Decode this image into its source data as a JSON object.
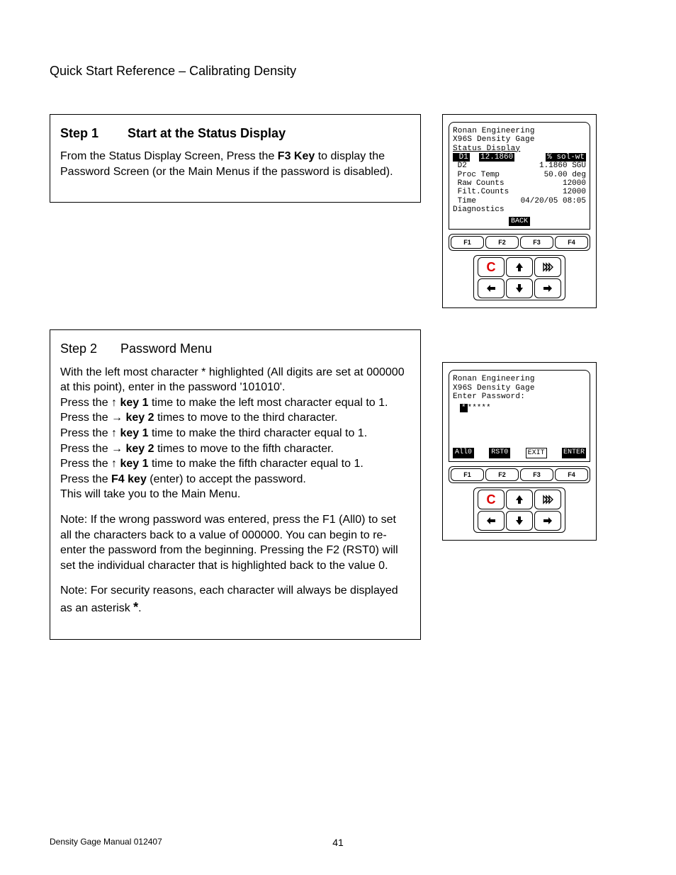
{
  "page_title": "Quick Start Reference – Calibrating Density",
  "step1": {
    "label": "Step 1",
    "heading": "Start at the Status Display",
    "body_pre": "From the Status Display Screen, Press the ",
    "key": "F3 Key",
    "body_post": " to display the Password Screen (or the Main Menus if the password is disabled)."
  },
  "step2": {
    "label": "Step 2",
    "heading": "Password Menu",
    "intro": "With the left most character * highlighted (All digits are set at 000000 at this point), enter in the password '101010'.",
    "lines": [
      {
        "pre": "Press the ",
        "arrow": "↑",
        "mid": "  ",
        "key": "key 1",
        "post": " time to make the left most character equal to 1."
      },
      {
        "pre": "Press the ",
        "arrow": "→",
        "mid": " ",
        "key": "key 2",
        "post": " times to move to the third character."
      },
      {
        "pre": "Press the ",
        "arrow": "↑",
        "mid": "  ",
        "key": "key 1",
        "post": " time to make the third character equal to 1."
      },
      {
        "pre": "Press the ",
        "arrow": "→",
        "mid": " ",
        "key": "key 2",
        "post": " times to move to the fifth character."
      },
      {
        "pre": "Press the ",
        "arrow": "↑",
        "mid": "  ",
        "key": "key 1",
        "post": " time to make the fifth character equal to 1."
      }
    ],
    "f4_pre": "Press the ",
    "f4_key": "F4 key",
    "f4_post": " (enter) to accept the password.",
    "tail": "This will take you to the Main Menu.",
    "note1": "Note:  If the wrong password was entered, press the F1 (All0) to set all the characters back to a value of 000000.  You can begin to re-enter the password from the beginning.  Pressing the F2 (RST0) will set the individual character that is highlighted back to the value 0.",
    "note2_pre": "Note:  For security reasons, each character will always be displayed as an asterisk ",
    "note2_star": "*",
    "note2_post": "."
  },
  "device1": {
    "l1": "Ronan Engineering",
    "l2": "X96S Density Gage",
    "l3": "Status Display",
    "d1_label": " D1",
    "d1_val": "12.1860",
    "d1_unit": "% sol-wt",
    "d2_label": " D2",
    "d2_val": "1.1860",
    "d2_unit": "SGU",
    "pt_label": " Proc Temp",
    "pt_val": "50.00",
    "pt_unit": "deg",
    "rc_label": " Raw Counts",
    "rc_val": "12000",
    "fc_label": " Filt.Counts",
    "fc_val": "12000",
    "tm_label": " Time",
    "tm_val": "04/20/05 08:05",
    "dg": " Diagnostics",
    "back": "BACK"
  },
  "device2": {
    "l1": "Ronan Engineering",
    "l2": "X96S Density Gage",
    "l3": "Enter Password:",
    "cursor": "*",
    "stars": "*****",
    "soft": [
      "All0",
      "RST0",
      "EXIT",
      "ENTER"
    ]
  },
  "fkeys": [
    "F1",
    "F2",
    "F3",
    "F4"
  ],
  "nav": {
    "c": "C"
  },
  "footer": {
    "left": "Density Gage Manual 012407",
    "center": "41"
  }
}
